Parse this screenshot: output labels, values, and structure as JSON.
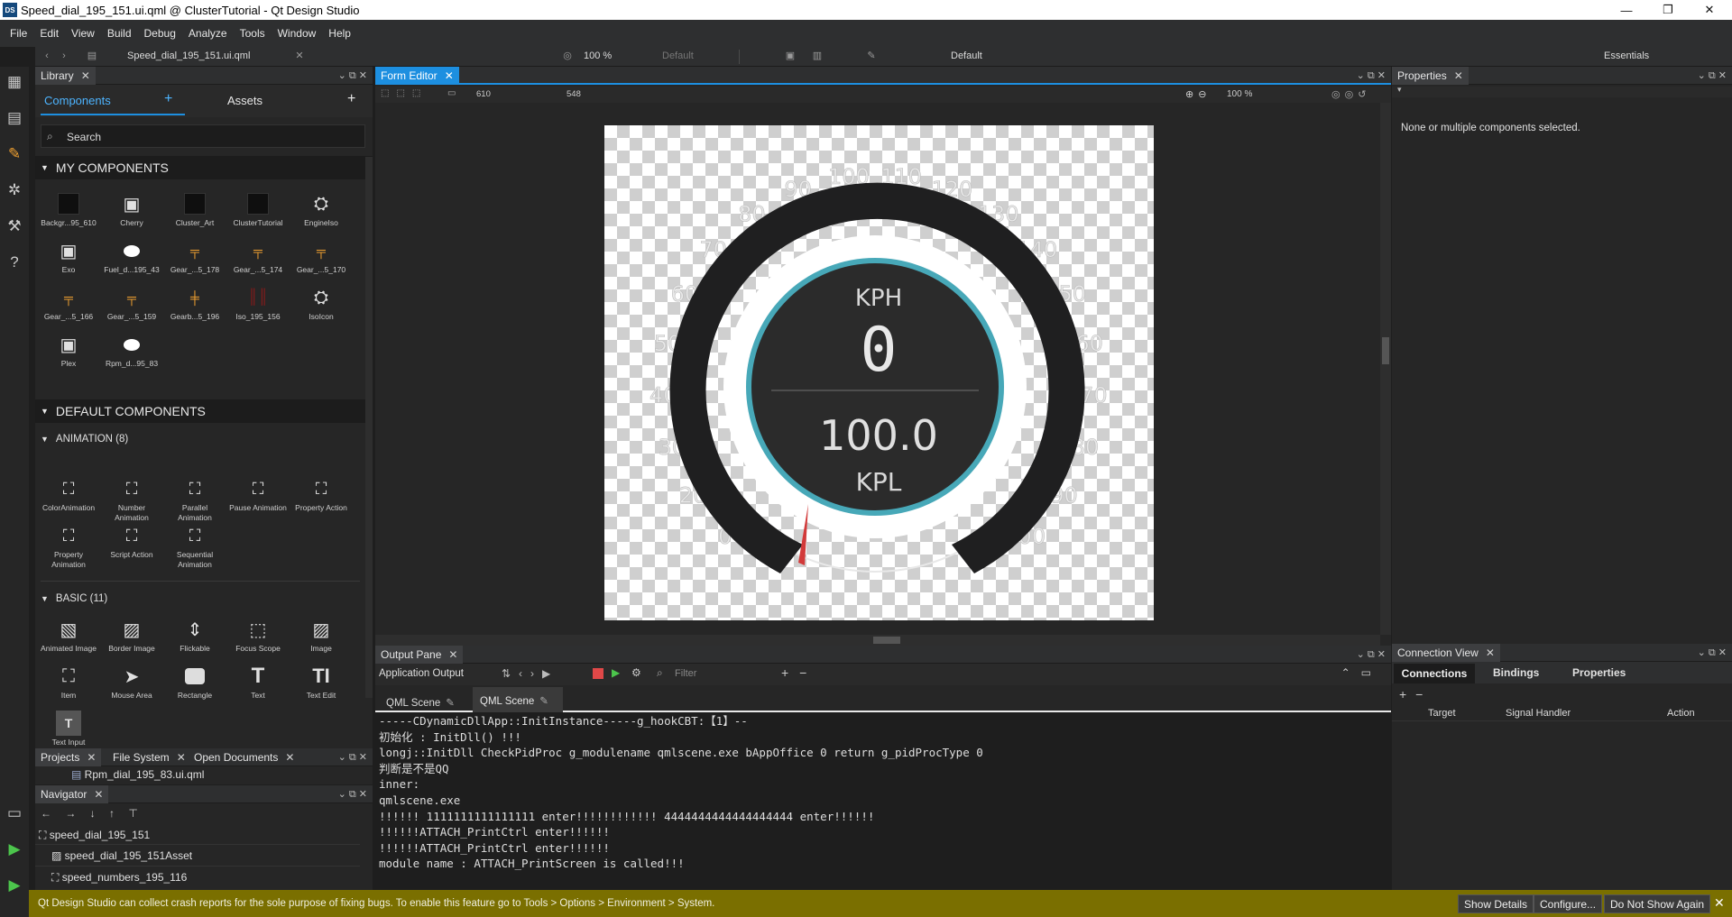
{
  "window": {
    "title": "Speed_dial_195_151.ui.qml @ ClusterTutorial - Qt Design Studio",
    "app_icon": "DS",
    "controls": [
      "—",
      "❐",
      "✕"
    ]
  },
  "menu": [
    "File",
    "Edit",
    "View",
    "Build",
    "Debug",
    "Analyze",
    "Tools",
    "Window",
    "Help"
  ],
  "toolbar": {
    "file_name": "Speed_dial_195_151.ui.qml",
    "zoom": "100 %",
    "state": "Default",
    "style": "Default",
    "workspace": "Essentials"
  },
  "library": {
    "tab_title": "Library",
    "tabs": [
      "Components",
      "Assets"
    ],
    "search_placeholder": "Search",
    "my_components_header": "MY COMPONENTS",
    "my_components": [
      {
        "label": "Backgr...95_610",
        "icon": "black-square-icon"
      },
      {
        "label": "Cherry",
        "icon": "chip-icon"
      },
      {
        "label": "Cluster_Art",
        "icon": "black-square-icon"
      },
      {
        "label": "ClusterTutorial",
        "icon": "black-square-icon"
      },
      {
        "label": "EngineIso",
        "icon": "engine-icon"
      },
      {
        "label": "Exo",
        "icon": "chip-icon"
      },
      {
        "label": "Fuel_d...195_43",
        "icon": "white-oval-icon"
      },
      {
        "label": "Gear_...5_178",
        "icon": "gear-shift-icon"
      },
      {
        "label": "Gear_...5_174",
        "icon": "gear-shift-icon"
      },
      {
        "label": "Gear_...5_170",
        "icon": "gear-shift-icon"
      },
      {
        "label": "Gear_...5_166",
        "icon": "gear-shift-icon"
      },
      {
        "label": "Gear_...5_159",
        "icon": "gear-shift-icon"
      },
      {
        "label": "Gearb...5_196",
        "icon": "gearbox-icon"
      },
      {
        "label": "Iso_195_156",
        "icon": "red-bars-icon"
      },
      {
        "label": "IsoIcon",
        "icon": "engine-icon"
      },
      {
        "label": "Plex",
        "icon": "chip-icon"
      },
      {
        "label": "Rpm_d...95_83",
        "icon": "white-oval-icon"
      }
    ],
    "default_components_header": "DEFAULT COMPONENTS",
    "animation_header": "ANIMATION (8)",
    "animation": [
      "ColorAnimation",
      "Number Animation",
      "Parallel Animation",
      "Pause Animation",
      "Property Action",
      "Property Animation",
      "Script Action",
      "Sequential Animation"
    ],
    "basic_header": "BASIC (11)",
    "basic": [
      {
        "label": "Animated Image",
        "icon": "animated-image-icon"
      },
      {
        "label": "Border Image",
        "icon": "border-image-icon"
      },
      {
        "label": "Flickable",
        "icon": "flickable-icon"
      },
      {
        "label": "Focus Scope",
        "icon": "focus-scope-icon"
      },
      {
        "label": "Image",
        "icon": "image-icon"
      },
      {
        "label": "Item",
        "icon": "item-icon"
      },
      {
        "label": "Mouse Area",
        "icon": "mouse-area-icon"
      },
      {
        "label": "Rectangle",
        "icon": "rectangle-icon"
      },
      {
        "label": "Text",
        "icon": "text-icon"
      },
      {
        "label": "Text Edit",
        "icon": "text-edit-icon"
      },
      {
        "label": "Text Input",
        "icon": "text-input-icon"
      }
    ]
  },
  "projects": {
    "tabs": [
      "Projects",
      "File System",
      "Open Documents"
    ],
    "file": "Rpm_dial_195_83.ui.qml"
  },
  "navigator": {
    "title": "Navigator",
    "nodes": [
      "speed_dial_195_151",
      "speed_dial_195_151Asset",
      "speed_numbers_195_116"
    ]
  },
  "form_editor": {
    "tab_title": "Form Editor",
    "width_value": "610",
    "height_value": "548",
    "zoom": "100 %",
    "gauge": {
      "top_label": "KPH",
      "speed": "0",
      "value": "100.0",
      "bottom_label": "KPL",
      "ticks": [
        "0",
        "20",
        "30",
        "40",
        "50",
        "60",
        "70",
        "80",
        "90",
        "100",
        "110",
        "120",
        "130",
        "140",
        "150",
        "160",
        "170",
        "180",
        "190",
        "200"
      ],
      "accent": "#47a8b8",
      "needle_color": "#d23a3a"
    }
  },
  "properties": {
    "title": "Properties",
    "message": "None or multiple components selected."
  },
  "output": {
    "title": "Output Pane",
    "label": "Application Output",
    "filter_placeholder": "Filter",
    "tabs": [
      "QML Scene",
      "QML Scene"
    ],
    "lines": [
      "-----CDynamicDllApp::InitInstance-----g_hookCBT:【1】--",
      "初始化 : InitDll() !!!",
      "longj::InitDll CheckPidProc g_modulename qmlscene.exe bAppOffice 0 return g_pidProcType 0",
      "判断是不是QQ",
      "inner:",
      "qmlscene.exe",
      "!!!!!! 1111111111111111 enter!!!!!!!!!!!! 4444444444444444444 enter!!!!!!",
      "!!!!!!ATTACH_PrintCtrl enter!!!!!!",
      "!!!!!!ATTACH_PrintCtrl enter!!!!!!",
      "module name : ATTACH_PrintScreen is called!!!"
    ]
  },
  "connections": {
    "title": "Connection View",
    "tabs": [
      "Connections",
      "Bindings",
      "Properties"
    ],
    "columns": [
      "Target",
      "Signal Handler",
      "Action"
    ]
  },
  "banner": {
    "message": "Qt Design Studio can collect crash reports for the sole purpose of fixing bugs. To enable this feature go to Tools > Options > Environment > System.",
    "buttons": [
      "Show Details",
      "Configure...",
      "Do Not Show Again"
    ],
    "bg": "#7a6f00"
  }
}
